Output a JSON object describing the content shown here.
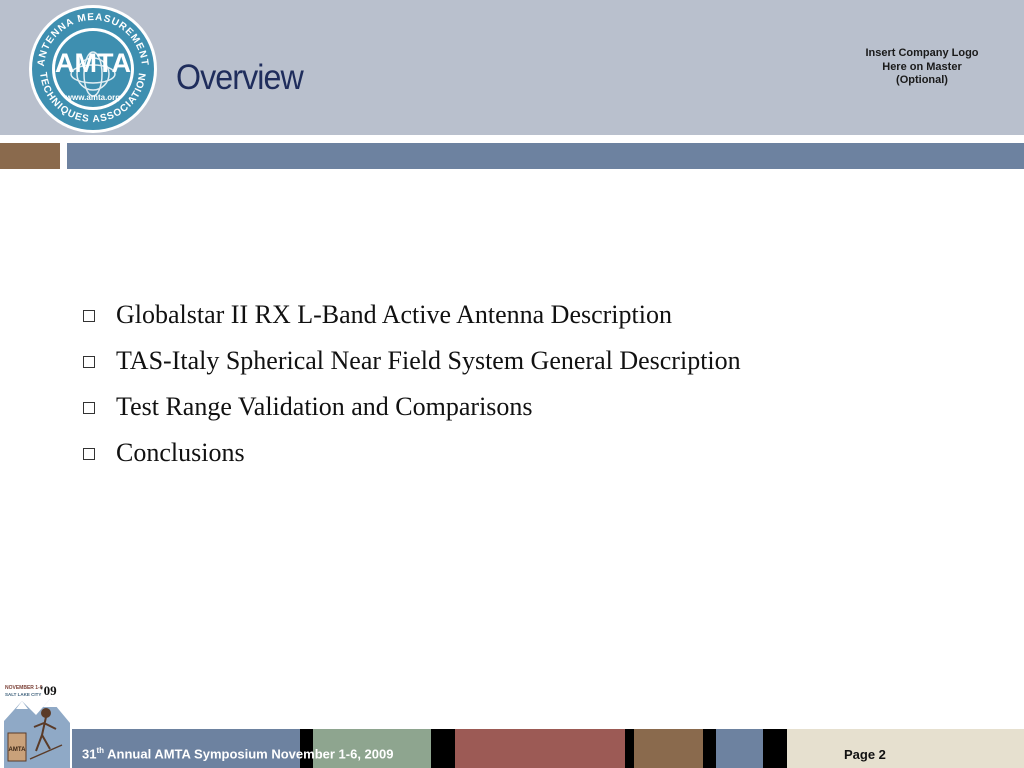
{
  "header": {
    "logo": {
      "name": "AMTA",
      "ring_text": "ANTENNA MEASUREMENT TECHNIQUES ASSOCIATION",
      "url": "www.amta.org"
    },
    "title": "Overview",
    "company_logo_note": [
      "Insert Company Logo",
      "Here on Master",
      "(Optional)"
    ]
  },
  "bullets": [
    "Globalstar II RX L-Band Active Antenna Description",
    "TAS-Italy Spherical Near Field System General Description",
    "Test Range Validation and Comparisons",
    "Conclusions"
  ],
  "footer": {
    "event_number": "31",
    "event_suffix": "th",
    "event_text": " Annual AMTA Symposium November 1-6, 2009",
    "page_label": "Page 2"
  },
  "symposium_logo": {
    "line1": "NOVEMBER 1-6",
    "year": "'09",
    "line2": "SALT LAKE CITY",
    "badge": "AMTA"
  },
  "colors": {
    "header_bg": "#b9c0cd",
    "title": "#1f2d5c",
    "band_brown": "#8a6a4d",
    "band_blue": "#6d82a0",
    "footer_blue": "#6d82a0",
    "footer_sage": "#8ea58f",
    "footer_red": "#9c5a55",
    "footer_brown": "#8a6a4d",
    "footer_beige": "#e6e0cf"
  }
}
